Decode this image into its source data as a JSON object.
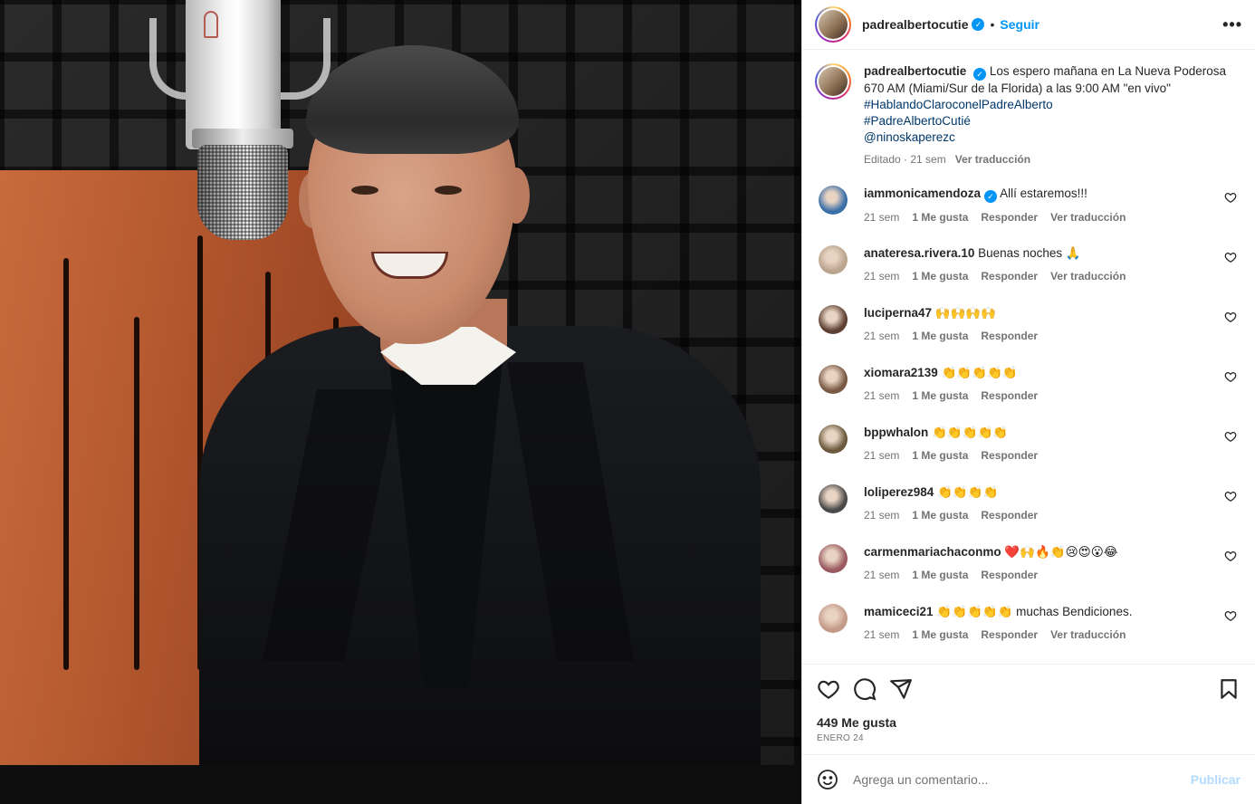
{
  "post": {
    "username": "padrealbertocutie",
    "follow_label": "Seguir",
    "more_label": "•••",
    "separator": "•"
  },
  "caption": {
    "username": "padrealbertocutie",
    "text": "Los espero mañana en La Nueva Poderosa 670 AM (Miami/Sur de la Florida) a las 9:00 AM \"en vivo\"",
    "tags": [
      "#HablandoClaroconelPadreAlberto",
      "#PadreAlbertoCutié",
      "@ninoskaperezc"
    ],
    "edited": "Editado · 21 sem",
    "translate": "Ver traducción"
  },
  "comments": [
    {
      "username": "iammonicamendoza",
      "verified": true,
      "text": "Allí estaremos!!!",
      "time": "21 sem",
      "likes": "1 Me gusta",
      "reply": "Responder",
      "translate": "Ver traducción",
      "avatar_color": "#3b6fa8"
    },
    {
      "username": "anateresa.rivera.10",
      "verified": false,
      "text": "Buenas noches 🙏",
      "time": "21 sem",
      "likes": "1 Me gusta",
      "reply": "Responder",
      "translate": "Ver traducción",
      "avatar_color": "#b9a48e"
    },
    {
      "username": "luciperna47",
      "verified": false,
      "text": "🙌🙌🙌🙌",
      "time": "21 sem",
      "likes": "1 Me gusta",
      "reply": "Responder",
      "translate": "",
      "avatar_color": "#5c4032"
    },
    {
      "username": "xiomara2139",
      "verified": false,
      "text": "👏👏👏👏👏",
      "time": "21 sem",
      "likes": "1 Me gusta",
      "reply": "Responder",
      "translate": "",
      "avatar_color": "#7a5a46"
    },
    {
      "username": "bppwhalon",
      "verified": false,
      "text": "👏👏👏👏👏",
      "time": "21 sem",
      "likes": "1 Me gusta",
      "reply": "Responder",
      "translate": "",
      "avatar_color": "#6b5a3e"
    },
    {
      "username": "loliperez984",
      "verified": false,
      "text": "👏👏👏👏",
      "time": "21 sem",
      "likes": "1 Me gusta",
      "reply": "Responder",
      "translate": "",
      "avatar_color": "#4a4a4a"
    },
    {
      "username": "carmenmariachaconmo",
      "verified": false,
      "text": "❤️🙌🔥👏😢😍😮😂",
      "time": "21 sem",
      "likes": "1 Me gusta",
      "reply": "Responder",
      "translate": "",
      "avatar_color": "#9a5a60"
    },
    {
      "username": "mamiceci21",
      "verified": false,
      "text": "👏👏👏👏👏 muchas Bendiciones.",
      "time": "21 sem",
      "likes": "1 Me gusta",
      "reply": "Responder",
      "translate": "Ver traducción",
      "avatar_color": "#c49a8a"
    }
  ],
  "actions": {
    "icons": [
      "heart-icon",
      "comment-icon",
      "share-icon",
      "bookmark-icon"
    ],
    "likes": "449 Me gusta",
    "date": "ENERO 24"
  },
  "composer": {
    "placeholder": "Agrega un comentario...",
    "publish_label": "Publicar",
    "emoji_icon": "smiley-icon"
  },
  "colors": {
    "accent": "#0095f6",
    "link": "#00376b",
    "muted": "#737373",
    "publish_disabled": "#b3dbff"
  }
}
